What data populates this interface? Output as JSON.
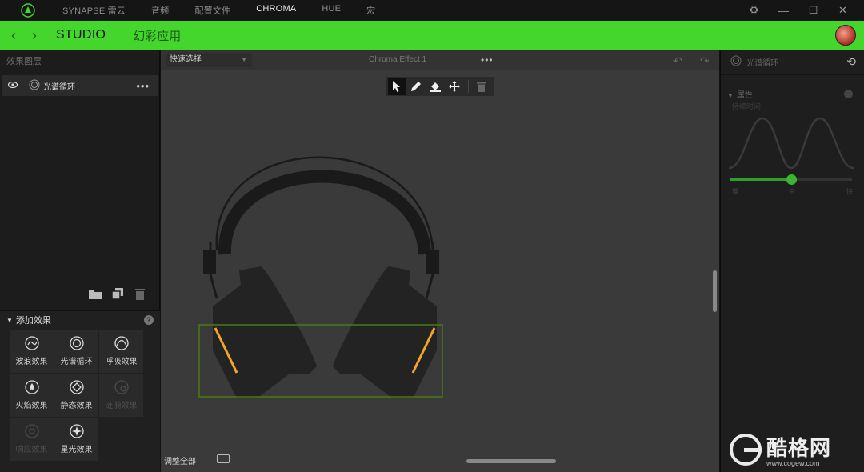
{
  "topbar": {
    "nav": [
      "SYNAPSE 雷云",
      "音频",
      "配置文件",
      "CHROMA",
      "HUE",
      "宏"
    ],
    "active_index": 3,
    "settings_icon": "gear-icon",
    "window_controls": [
      "minimize-icon",
      "maximize-icon",
      "close-icon"
    ]
  },
  "greenbar": {
    "back_icon": "chevron-left-icon",
    "forward_icon": "chevron-right-icon",
    "studio": "STUDIO",
    "chroma_apps": "幻彩应用",
    "accent": "#44d62c"
  },
  "left": {
    "layers_header": "效果图层",
    "layer": {
      "name": "光谱循环",
      "more": "•••"
    },
    "add_effects_header": "添加效果",
    "effects": [
      {
        "label": "波浪效果",
        "icon": "wave-icon",
        "enabled": true
      },
      {
        "label": "光谱循环",
        "icon": "spectrum-icon",
        "enabled": true
      },
      {
        "label": "呼吸效果",
        "icon": "breathing-icon",
        "enabled": true
      },
      {
        "label": "火焰效果",
        "icon": "fire-icon",
        "enabled": true
      },
      {
        "label": "静态效果",
        "icon": "static-icon",
        "enabled": true
      },
      {
        "label": "涟漪效果",
        "icon": "ripple-icon",
        "enabled": false
      },
      {
        "label": "响应效果",
        "icon": "reactive-icon",
        "enabled": false
      },
      {
        "label": "星光效果",
        "icon": "starlight-icon",
        "enabled": true
      }
    ]
  },
  "canvas": {
    "quick_select": "快速选择",
    "effect_name": "Chroma Effect 1",
    "more": "•••",
    "fit_all": "调整全部",
    "tools": [
      "pointer-tool-icon",
      "pencil-tool-icon",
      "fill-tool-icon",
      "move-tool-icon",
      "trash-icon"
    ],
    "highlight_color": "#f5a623",
    "selection_color": "#4a7a10"
  },
  "right": {
    "effect_name": "光谱循环",
    "properties_header": "属性",
    "speed_label": "持续时间",
    "slider_value": 0.5,
    "slider_ticks": [
      "慢",
      "中",
      "快"
    ],
    "slider_color": "#39b52f"
  },
  "watermark": {
    "brand": "酷格网",
    "url": "www.cogew.com"
  }
}
